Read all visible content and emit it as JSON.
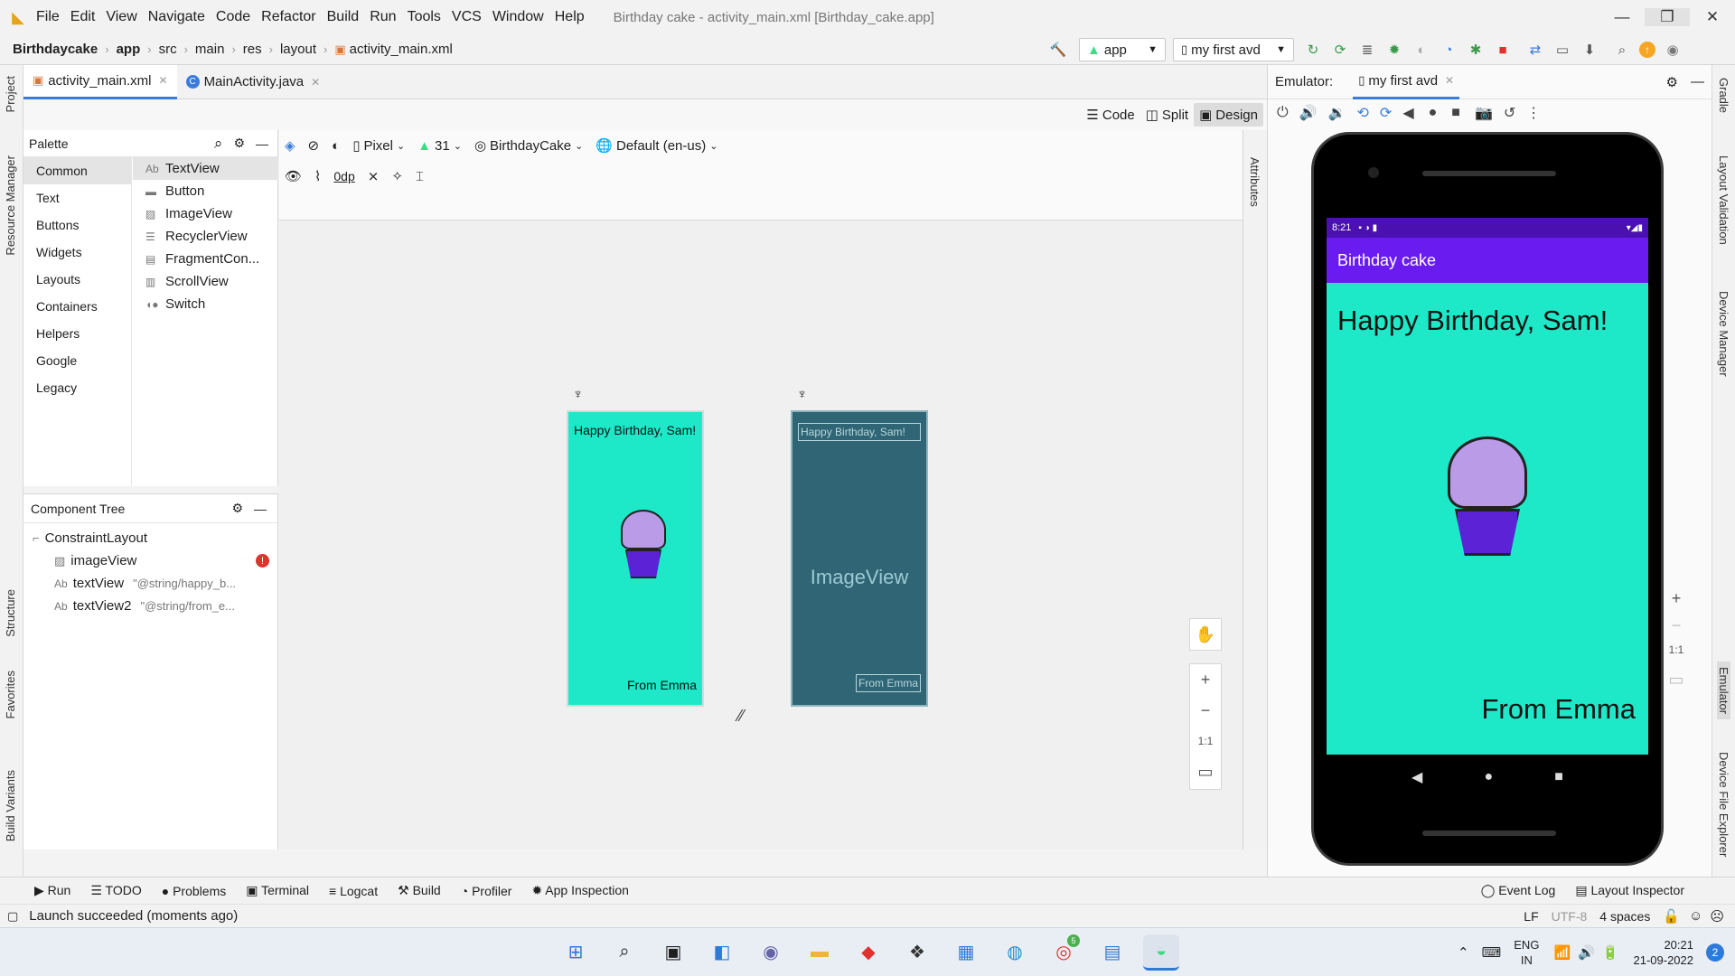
{
  "window": {
    "title": "Birthday cake - activity_main.xml [Birthday_cake.app]",
    "menu": [
      "File",
      "Edit",
      "View",
      "Navigate",
      "Code",
      "Refactor",
      "Build",
      "Run",
      "Tools",
      "VCS",
      "Window",
      "Help"
    ],
    "controls": {
      "minimize": "—",
      "maximize": "❐",
      "close": "✕"
    }
  },
  "breadcrumb": [
    "Birthdaycake",
    "app",
    "src",
    "main",
    "res",
    "layout",
    "activity_main.xml"
  ],
  "run_config": {
    "module": "app",
    "device": "my first avd"
  },
  "left_stripe": [
    "Project",
    "Resource Manager",
    "Structure",
    "Favorites",
    "Build Variants"
  ],
  "right_stripe": [
    "Gradle",
    "Layout Validation",
    "Device Manager",
    "Emulator",
    "Device File Explorer"
  ],
  "editor_tabs": [
    {
      "label": "activity_main.xml",
      "active": true
    },
    {
      "label": "MainActivity.java",
      "active": false
    }
  ],
  "view_modes": {
    "code": "Code",
    "split": "Split",
    "design": "Design"
  },
  "palette": {
    "title": "Palette",
    "categories": [
      "Common",
      "Text",
      "Buttons",
      "Widgets",
      "Layouts",
      "Containers",
      "Helpers",
      "Google",
      "Legacy"
    ],
    "selected_category": "Common",
    "items": [
      "TextView",
      "Button",
      "ImageView",
      "RecyclerView",
      "FragmentCon...",
      "ScrollView",
      "Switch"
    ],
    "selected_item": "TextView"
  },
  "component_tree": {
    "title": "Component Tree",
    "root": "ConstraintLayout",
    "children": [
      {
        "name": "imageView",
        "ref": "",
        "error": true
      },
      {
        "name": "textView",
        "ref": "\"@string/happy_b...",
        "error": false
      },
      {
        "name": "textView2",
        "ref": "\"@string/from_e...",
        "error": false
      }
    ]
  },
  "design_toolbar": {
    "device": "Pixel",
    "api": "31",
    "theme": "BirthdayCake",
    "locale": "Default (en-us)",
    "margin": "0dp"
  },
  "preview": {
    "greeting": "Happy Birthday, Sam!",
    "signature": "From Emma",
    "blueprint_label": "ImageView"
  },
  "attributes_label": "Attributes",
  "zoom": {
    "plus": "+",
    "minus": "−",
    "one": "1:1"
  },
  "emulator": {
    "label": "Emulator:",
    "avd_tab": "my first avd",
    "status_time": "8:21",
    "app_title": "Birthday cake",
    "greeting": "Happy Birthday, Sam!",
    "signature": "From Emma"
  },
  "tool_windows": [
    "Run",
    "TODO",
    "Problems",
    "Terminal",
    "Logcat",
    "Build",
    "Profiler",
    "App Inspection"
  ],
  "tool_windows_right": [
    "Event Log",
    "Layout Inspector"
  ],
  "status": {
    "message": "Launch succeeded (moments ago)",
    "line_sep": "LF",
    "encoding": "UTF-8",
    "indent": "4 spaces"
  },
  "taskbar": {
    "lang": "ENG",
    "region": "IN",
    "time": "20:21",
    "date": "21-09-2022",
    "notifications": "2",
    "badge": "5"
  },
  "colors": {
    "accent": "#3c7bd9",
    "teal": "#1de9c9",
    "purple": "#6a1bf0",
    "blueprint": "#2f6574",
    "error": "#e0322f"
  }
}
